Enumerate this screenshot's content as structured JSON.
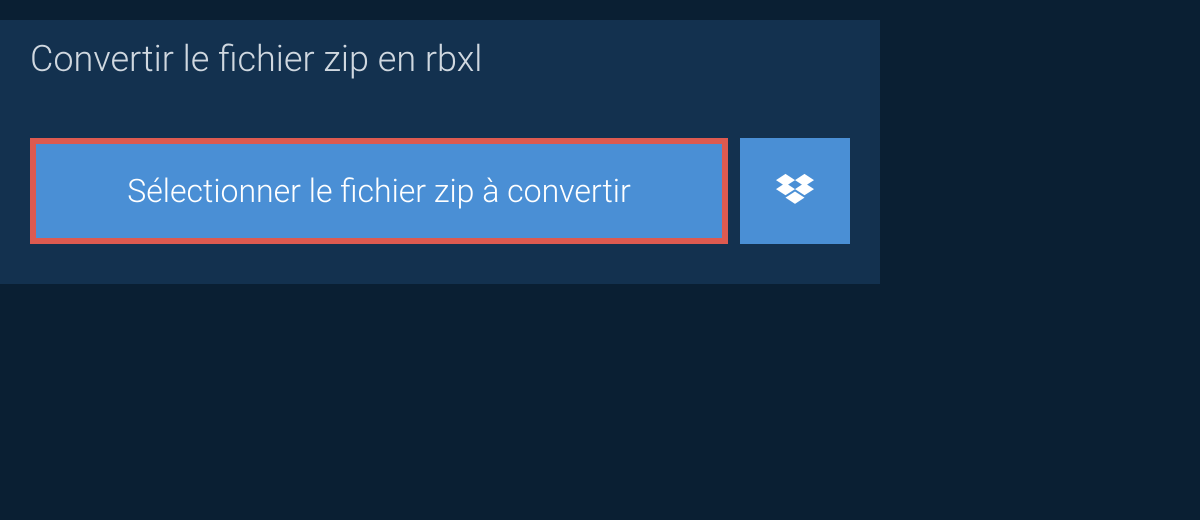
{
  "title": "Convertir le fichier zip en rbxl",
  "buttons": {
    "select_file_label": "Sélectionner le fichier zip à convertir"
  },
  "colors": {
    "page_bg": "#0a1f33",
    "panel_bg": "#13314f",
    "button_bg": "#4a8fd5",
    "highlight_border": "#dd5a50",
    "title_text": "#d0d8e0",
    "button_text": "#ffffff"
  }
}
